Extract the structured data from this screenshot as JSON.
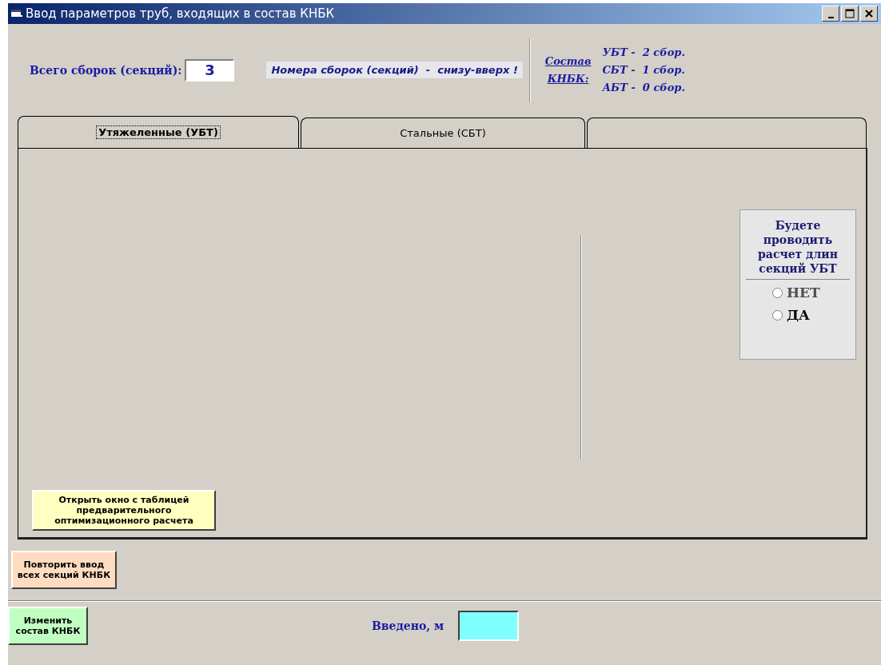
{
  "window": {
    "title": "Ввод параметров труб, входящих в состав КНБК"
  },
  "sections_total": {
    "label": "Всего сборок (секций):",
    "value": "3"
  },
  "note": "Номера сборок (секций)  -  снизу-вверх !",
  "composition": {
    "label_lines": [
      "Состав",
      "КНБК:"
    ],
    "items": [
      "УБТ -  2 сбор.",
      "СБТ -  1 сбор.",
      "АБТ -  0 сбор."
    ]
  },
  "tabs": [
    {
      "label": "Утяжеленные (УБТ)",
      "selected": true
    },
    {
      "label": "Стальные (СБТ)",
      "selected": false
    },
    {
      "selected": false
    }
  ],
  "calc_question": {
    "title": "Будете проводить расчет длин секций УБТ",
    "options": [
      {
        "label": "НЕТ",
        "selected": false,
        "disabled": true
      },
      {
        "label": "ДА",
        "selected": false,
        "disabled": false
      }
    ]
  },
  "buttons": [
    {
      "kind": "open-table",
      "label": "Открыть окно с таблицей предварительного оптимизационного расчета"
    },
    {
      "kind": "repeat",
      "label": "Повторить ввод всех секций КНБК"
    },
    {
      "kind": "change",
      "label": "Изменить состав КНБК"
    }
  ],
  "entered": {
    "label": "Введено, м"
  }
}
